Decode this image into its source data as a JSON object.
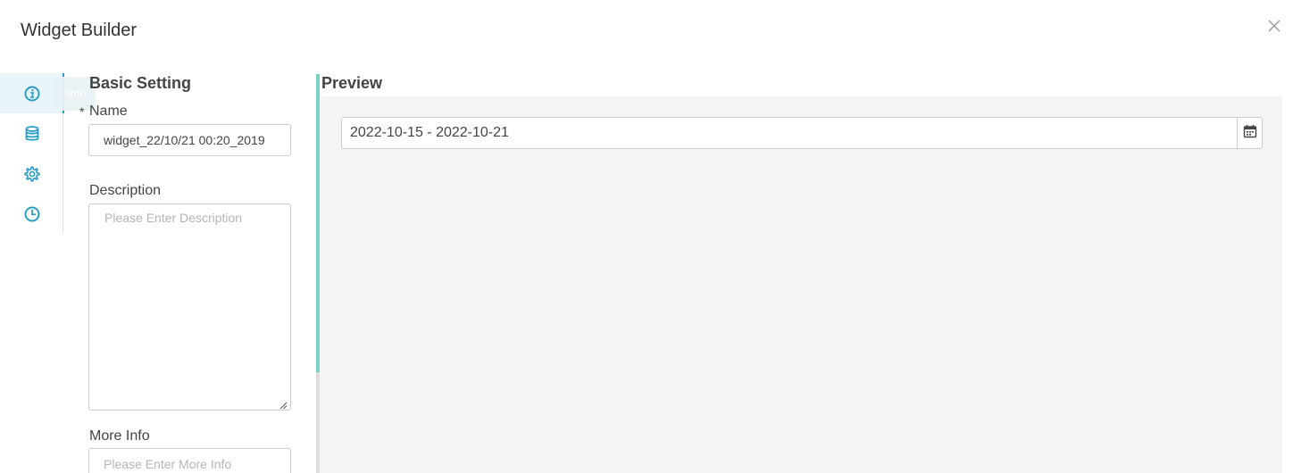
{
  "dialog": {
    "title": "Widget Builder"
  },
  "rail": {
    "items": [
      {
        "icon": "info-icon",
        "active": true
      },
      {
        "icon": "database-icon",
        "active": false
      },
      {
        "icon": "gear-icon",
        "active": false
      },
      {
        "icon": "clock-icon",
        "active": false
      }
    ],
    "tooltip": "Info"
  },
  "basic": {
    "title": "Basic Setting",
    "name_label": "Name",
    "name_required_mark": "*",
    "name_value": "widget_22/10/21 00:20_2019",
    "description_label": "Description",
    "description_placeholder": "Please Enter Description",
    "more_info_label": "More Info",
    "more_info_placeholder": "Please Enter More Info"
  },
  "preview": {
    "title": "Preview",
    "date_range": "2022-10-15 - 2022-10-21"
  },
  "colors": {
    "accent": "#2a9fc5",
    "scroll_thumb": "#79d2c6",
    "preview_bg": "#f4f4f4"
  }
}
